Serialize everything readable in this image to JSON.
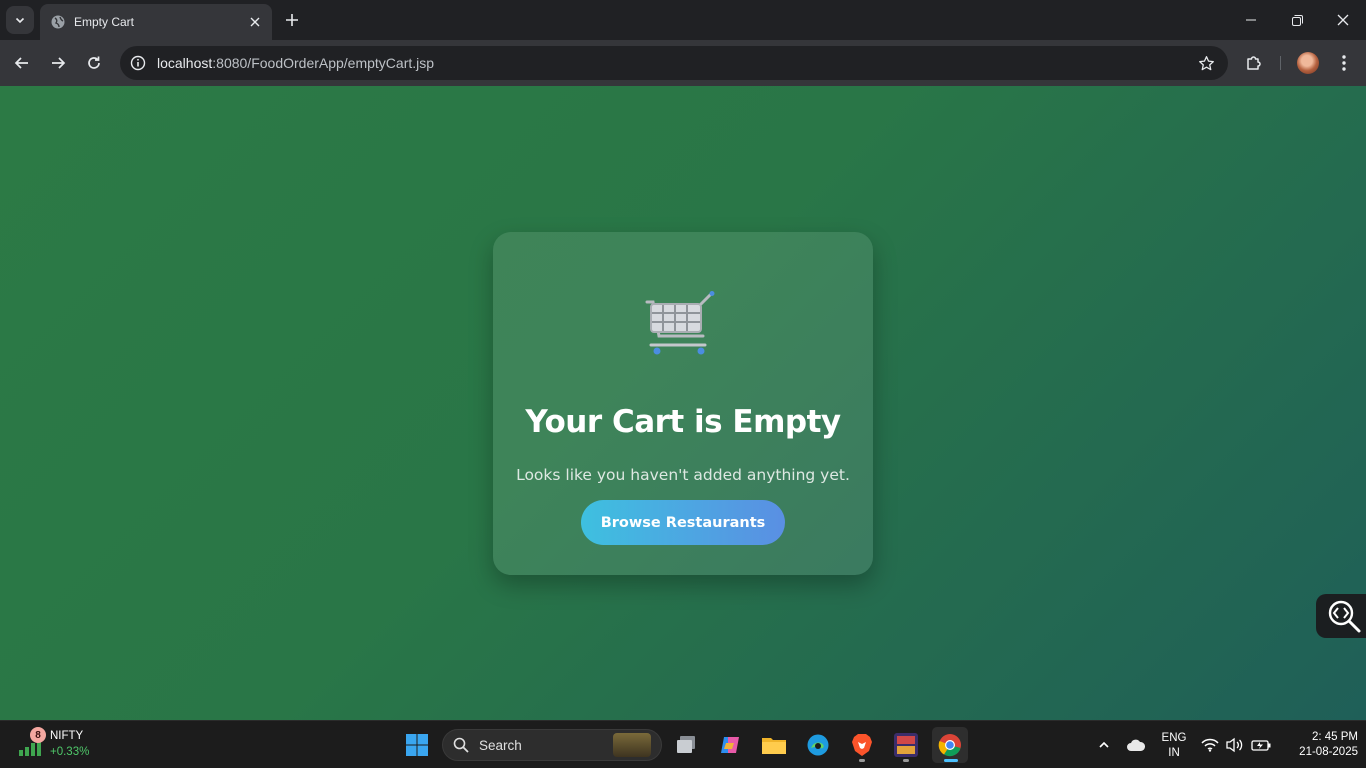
{
  "browser": {
    "tab_title": "Empty Cart",
    "url_host": "localhost",
    "url_rest": ":8080/FoodOrderApp/emptyCart.jsp"
  },
  "page": {
    "heading": "Your Cart is Empty",
    "subtitle": "Looks like you haven't added anything yet.",
    "button_label": "Browse Restaurants",
    "icon": "shopping-cart-icon"
  },
  "taskbar": {
    "stock_badge": "8",
    "stock_name": "NIFTY",
    "stock_change": "+0.33%",
    "search_label": "Search",
    "lang_line1": "ENG",
    "lang_line2": "IN",
    "time": "2: 45 PM",
    "date": "21-08-2025"
  },
  "colors": {
    "bg_gradient_start": "#2c7a45",
    "bg_gradient_end": "#1f5f58",
    "button_gradient_start": "#3ec0e0",
    "button_gradient_end": "#5a8fe3",
    "stock_positive": "#4fc86a"
  }
}
